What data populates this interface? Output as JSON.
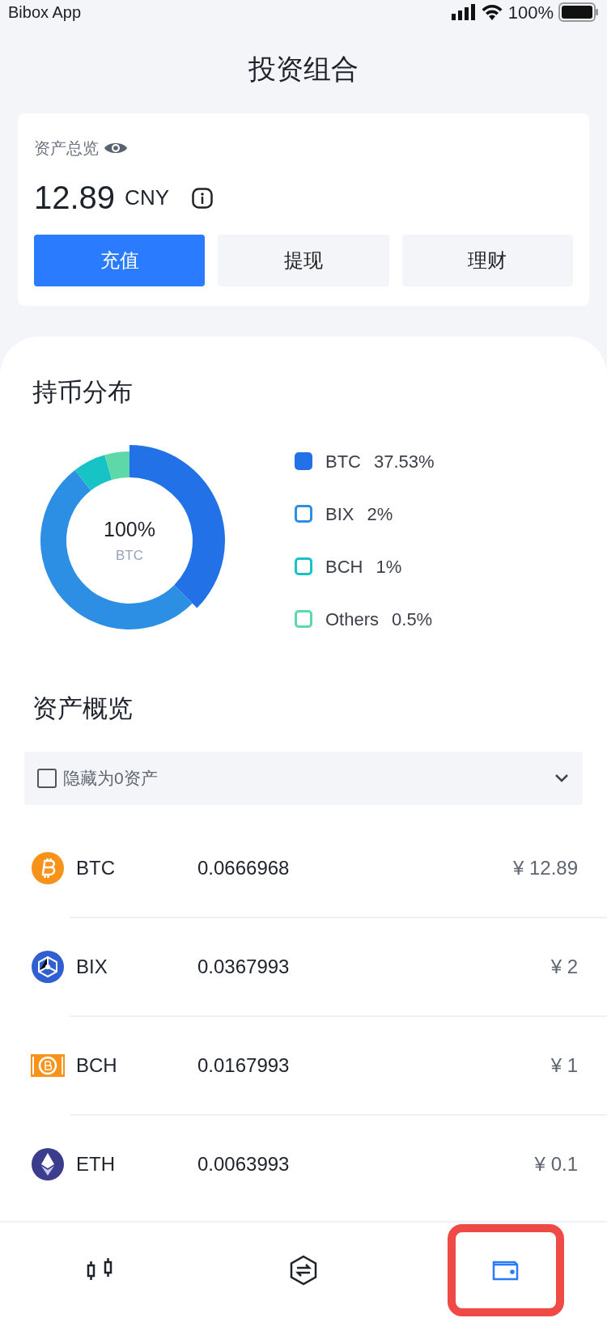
{
  "status_bar": {
    "app": "Bibox App",
    "battery": "100%"
  },
  "title": "投资组合",
  "summary": {
    "label": "资产总览",
    "amount": "12.89",
    "currency": "CNY",
    "buttons": [
      {
        "label": "充值",
        "primary": true
      },
      {
        "label": "提现",
        "primary": false
      },
      {
        "label": "理财",
        "primary": false
      }
    ]
  },
  "distribution": {
    "title": "持币分布",
    "center_value": "100%",
    "center_label": "BTC",
    "chart_data": {
      "type": "donut",
      "values": [
        37.5,
        52,
        6,
        4.5
      ],
      "colors": [
        "#2371e6",
        "#2d8fe3",
        "#17c3c4",
        "#5dd8a8"
      ]
    },
    "legend": [
      {
        "name": "BTC",
        "share": "37.53%",
        "color": "#2371e6",
        "selected": true
      },
      {
        "name": "BIX",
        "share": "2%",
        "color": "#2d8fe3",
        "selected": false
      },
      {
        "name": "BCH",
        "share": "1%",
        "color": "#17c3c4",
        "selected": false
      },
      {
        "name": "Others",
        "share": "0.5%",
        "color": "#5dd8a8",
        "selected": false
      }
    ]
  },
  "assets": {
    "title": "资产概览",
    "filter": {
      "label": "隐藏为0资产",
      "checked": false
    },
    "rows": [
      {
        "kind": "btc",
        "symbol": "BTC",
        "amount": "0.0666968",
        "value": "¥ 12.89"
      },
      {
        "kind": "bix",
        "symbol": "BIX",
        "amount": "0.0367993",
        "value": "¥ 2"
      },
      {
        "kind": "bch",
        "symbol": "BCH",
        "amount": "0.0167993",
        "value": "¥ 1"
      },
      {
        "kind": "eth",
        "symbol": "ETH",
        "amount": "0.0063993",
        "value": "¥ 0.1"
      }
    ]
  },
  "tabs": [
    {
      "kind": "market",
      "selected": false,
      "highlighted": false
    },
    {
      "kind": "trade",
      "selected": false,
      "highlighted": false
    },
    {
      "kind": "wallet",
      "selected": true,
      "highlighted": true
    }
  ]
}
